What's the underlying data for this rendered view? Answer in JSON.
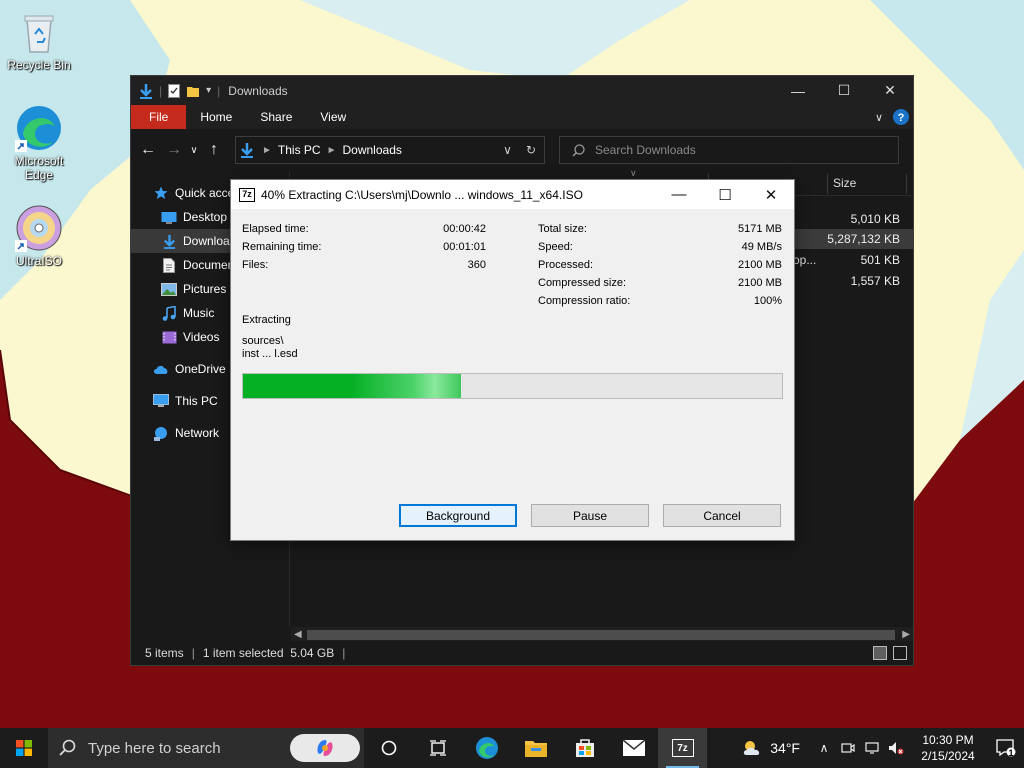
{
  "colors": {
    "sky": "#d9eef0",
    "cream": "#fbf8cf",
    "maroon": "#7d0a0d",
    "accent_blue": "#0078d7",
    "progress_green": "#06b025",
    "file_tab_red": "#c42b1c"
  },
  "desktop": {
    "icons": [
      {
        "label": "Recycle Bin",
        "icon": "recycle-bin-icon"
      },
      {
        "label": "Microsoft Edge",
        "icon": "edge-icon"
      },
      {
        "label": "UltraISO",
        "icon": "ultraiso-icon"
      }
    ]
  },
  "explorer": {
    "title": "Downloads",
    "ribbon_tabs": [
      "File",
      "Home",
      "Share",
      "View"
    ],
    "address": {
      "crumbs": [
        "This PC",
        "Downloads"
      ]
    },
    "search": {
      "placeholder": "Search Downloads"
    },
    "nav": [
      {
        "label": "Quick access",
        "icon": "star-icon"
      },
      {
        "label": "Desktop",
        "icon": "desktop-folder-icon"
      },
      {
        "label": "Downloads",
        "icon": "download-arrow-icon",
        "selected": true
      },
      {
        "label": "Documents",
        "icon": "documents-icon"
      },
      {
        "label": "Pictures",
        "icon": "pictures-icon"
      },
      {
        "label": "Music",
        "icon": "music-icon"
      },
      {
        "label": "Videos",
        "icon": "videos-icon"
      },
      {
        "label": "OneDrive",
        "icon": "cloud-icon"
      },
      {
        "label": "This PC",
        "icon": "computer-icon"
      },
      {
        "label": "Network",
        "icon": "network-icon"
      }
    ],
    "columns": {
      "size": "Size"
    },
    "files": [
      {
        "name": "",
        "size": "5,010 KB"
      },
      {
        "name": "",
        "size": "5,287,132 KB",
        "selected": true
      },
      {
        "name": "op...",
        "size": "501 KB"
      },
      {
        "name": "",
        "size": "1,557 KB"
      }
    ],
    "status": {
      "items": "5 items",
      "selection": "1 item selected  5.04 GB"
    }
  },
  "dialog": {
    "title": "40% Extracting C:\\Users\\mj\\Downlo ... windows_11_x64.ISO",
    "app_icon_text": "7z",
    "left_stats": [
      {
        "label": "Elapsed time:",
        "value": "00:00:42"
      },
      {
        "label": "Remaining time:",
        "value": "00:01:01"
      },
      {
        "label": "Files:",
        "value": "360"
      }
    ],
    "right_stats": [
      {
        "label": "Total size:",
        "value": "5171 MB"
      },
      {
        "label": "Speed:",
        "value": "49 MB/s"
      },
      {
        "label": "Processed:",
        "value": "2100 MB"
      },
      {
        "label": "Compressed size:",
        "value": "2100 MB"
      },
      {
        "label": "Compression ratio:",
        "value": "100%"
      }
    ],
    "operation": "Extracting",
    "current_path": "sources\\",
    "current_file": "inst ... l.esd",
    "progress_fraction": 0.405,
    "buttons": {
      "background": "Background",
      "pause": "Pause",
      "cancel": "Cancel"
    }
  },
  "taskbar": {
    "search_placeholder": "Type here to search",
    "apps": [
      {
        "name": "task-view-icon"
      },
      {
        "name": "widgets-icon"
      },
      {
        "name": "edge-icon"
      },
      {
        "name": "file-explorer-icon"
      },
      {
        "name": "store-icon"
      },
      {
        "name": "mail-icon"
      },
      {
        "name": "7zip-icon",
        "active": true
      }
    ],
    "weather": {
      "temp": "34°F"
    },
    "time": "10:30 PM",
    "date": "2/15/2024",
    "notification_count": "1"
  }
}
